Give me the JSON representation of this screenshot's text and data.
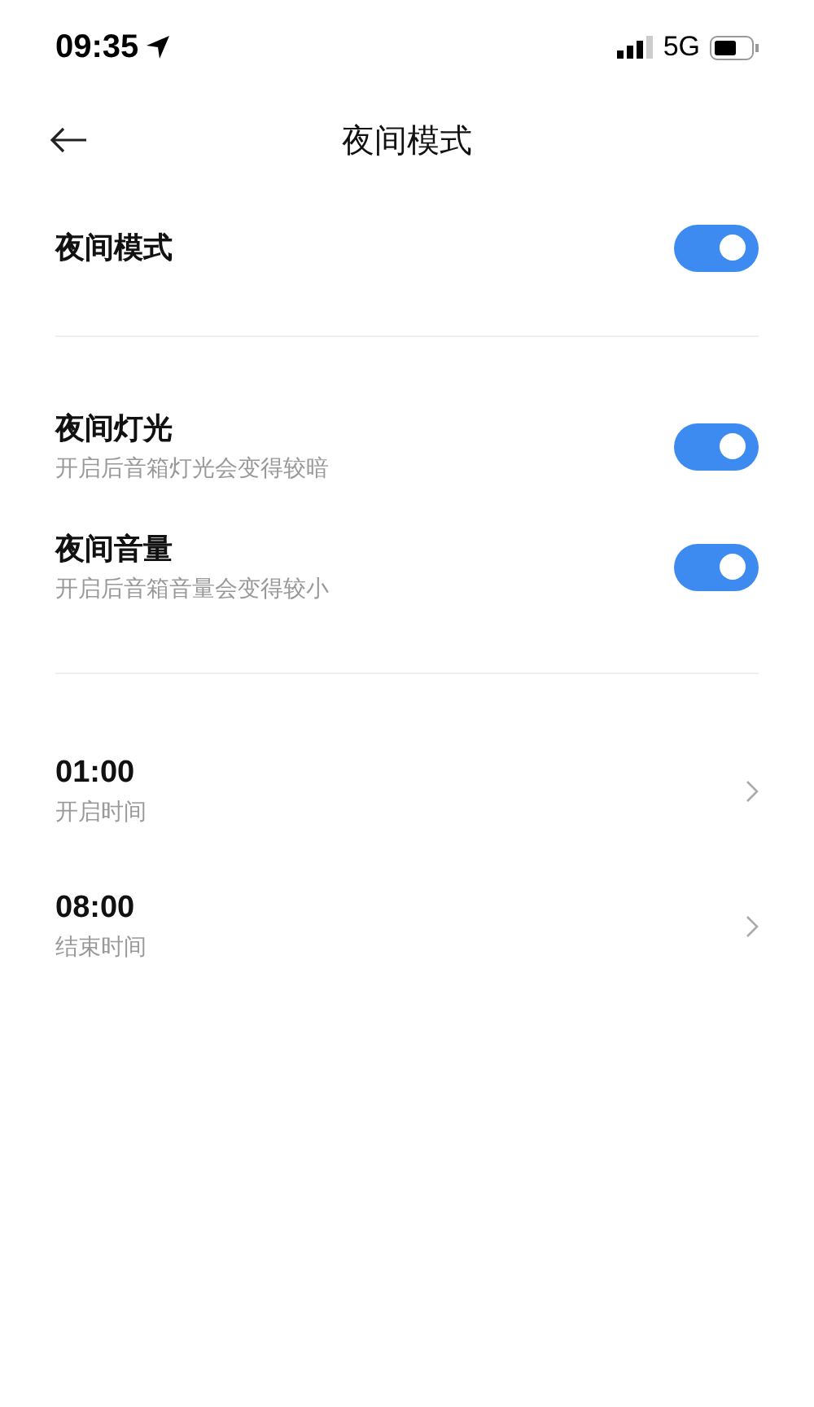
{
  "status_bar": {
    "time": "09:35",
    "network": "5G"
  },
  "header": {
    "title": "夜间模式"
  },
  "main_toggle": {
    "label": "夜间模式",
    "on": true
  },
  "options": [
    {
      "label": "夜间灯光",
      "description": "开启后音箱灯光会变得较暗",
      "on": true
    },
    {
      "label": "夜间音量",
      "description": "开启后音箱音量会变得较小",
      "on": true
    }
  ],
  "times": [
    {
      "value": "01:00",
      "label": "开启时间"
    },
    {
      "value": "08:00",
      "label": "结束时间"
    }
  ]
}
